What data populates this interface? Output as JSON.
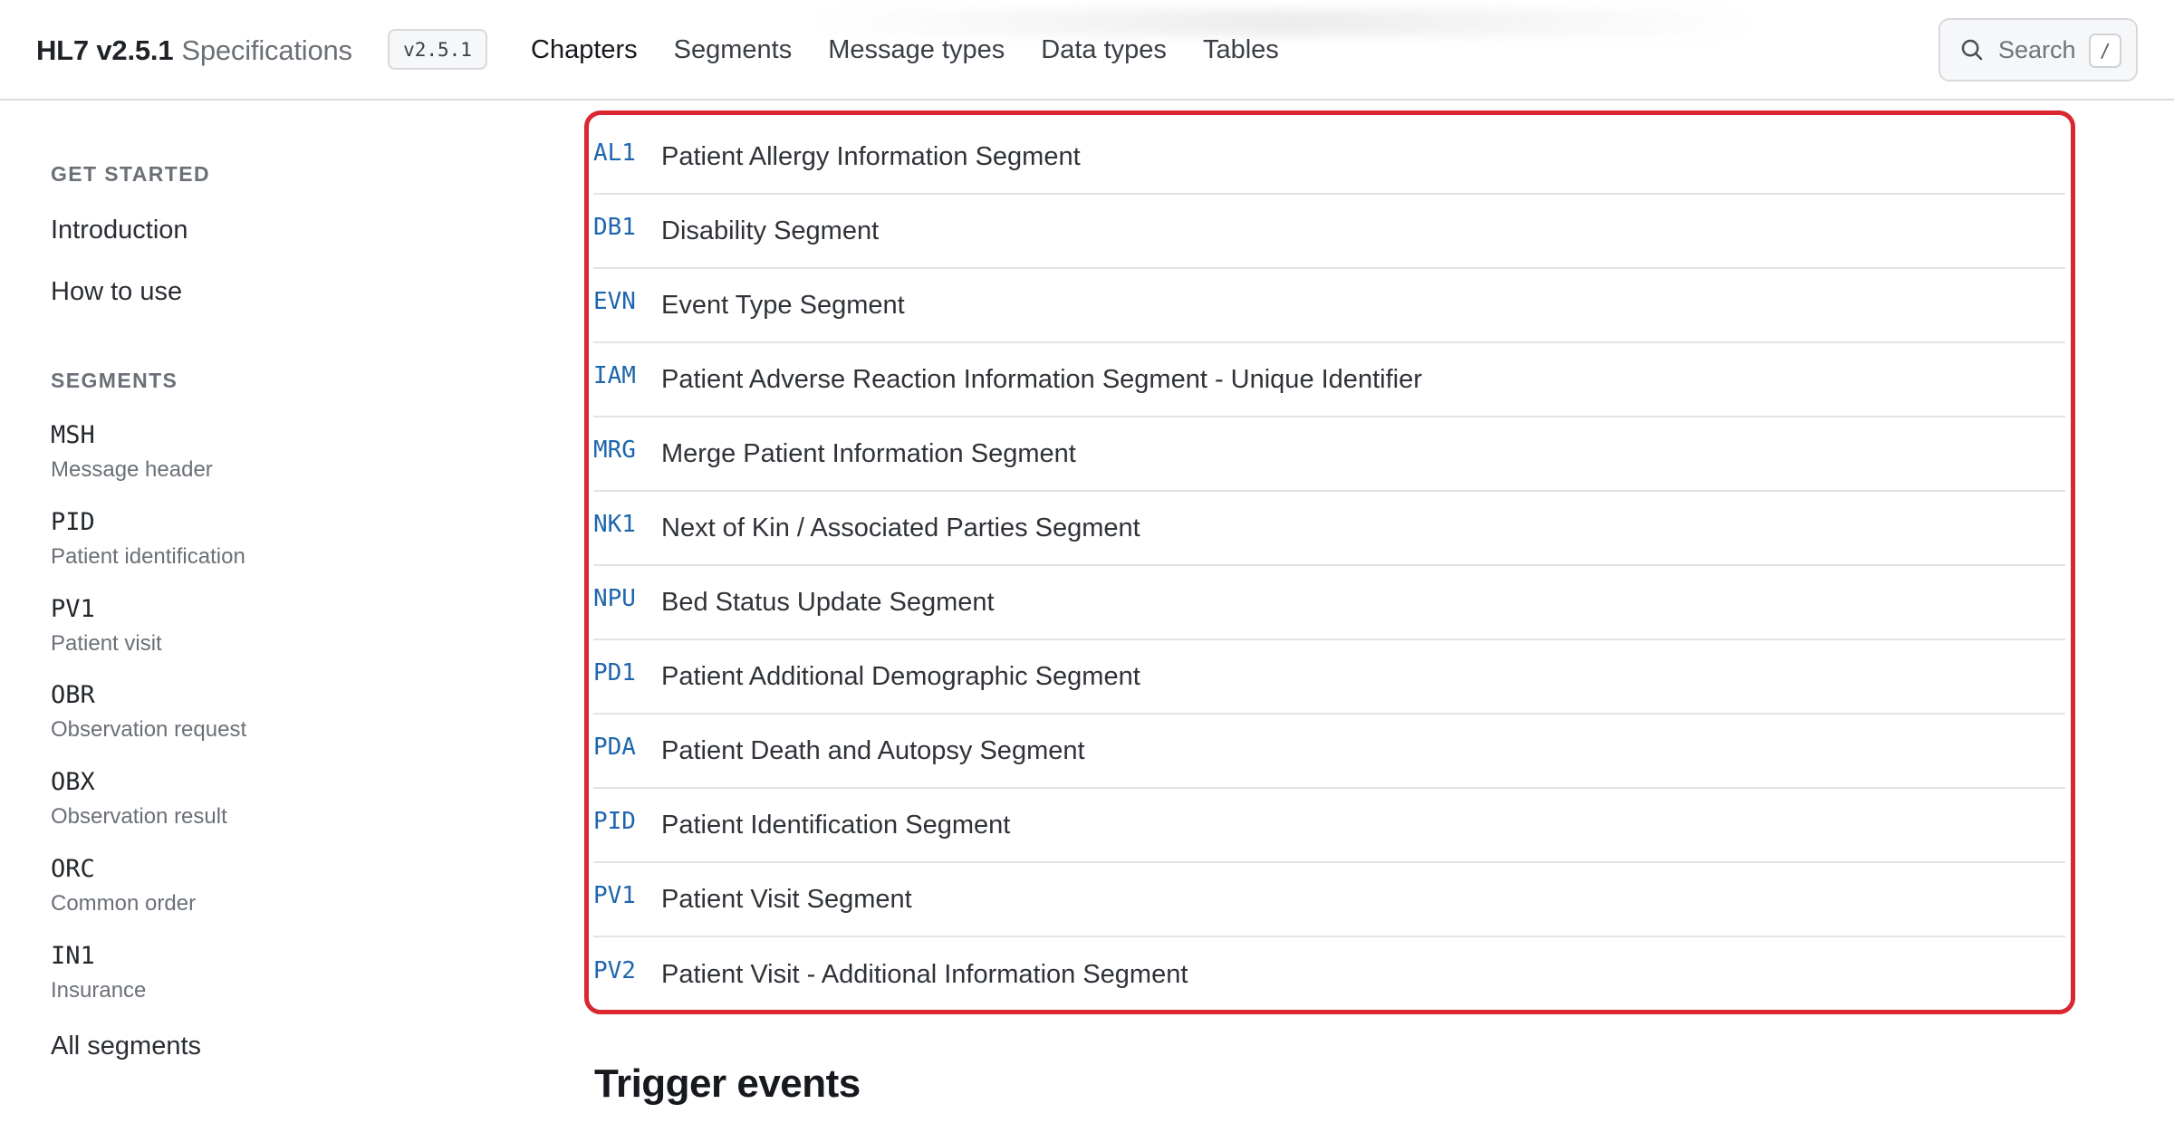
{
  "header": {
    "brand_strong": "HL7 v2.5.1",
    "brand_light": "Specifications",
    "version": "v2.5.1",
    "nav": [
      {
        "label": "Chapters"
      },
      {
        "label": "Segments"
      },
      {
        "label": "Message types"
      },
      {
        "label": "Data types"
      },
      {
        "label": "Tables"
      }
    ],
    "search": {
      "placeholder": "Search",
      "shortcut": "/"
    }
  },
  "sidebar": {
    "get_started_title": "GET STARTED",
    "get_started_links": [
      {
        "label": "Introduction"
      },
      {
        "label": "How to use"
      }
    ],
    "segments_title": "SEGMENTS",
    "segments": [
      {
        "code": "MSH",
        "desc": "Message header"
      },
      {
        "code": "PID",
        "desc": "Patient identification"
      },
      {
        "code": "PV1",
        "desc": "Patient visit"
      },
      {
        "code": "OBR",
        "desc": "Observation request"
      },
      {
        "code": "OBX",
        "desc": "Observation result"
      },
      {
        "code": "ORC",
        "desc": "Common order"
      },
      {
        "code": "IN1",
        "desc": "Insurance"
      }
    ],
    "all_segments": "All segments"
  },
  "main": {
    "segment_rows": [
      {
        "code": "AL1",
        "name": "Patient Allergy Information Segment"
      },
      {
        "code": "DB1",
        "name": "Disability Segment"
      },
      {
        "code": "EVN",
        "name": "Event Type Segment"
      },
      {
        "code": "IAM",
        "name": "Patient Adverse Reaction Information Segment - Unique Identifier"
      },
      {
        "code": "MRG",
        "name": "Merge Patient Information Segment"
      },
      {
        "code": "NK1",
        "name": "Next of Kin / Associated Parties Segment"
      },
      {
        "code": "NPU",
        "name": "Bed Status Update Segment"
      },
      {
        "code": "PD1",
        "name": "Patient Additional Demographic Segment"
      },
      {
        "code": "PDA",
        "name": "Patient Death and Autopsy Segment"
      },
      {
        "code": "PID",
        "name": "Patient Identification Segment"
      },
      {
        "code": "PV1",
        "name": "Patient Visit Segment"
      },
      {
        "code": "PV2",
        "name": "Patient Visit - Additional Information Segment"
      }
    ],
    "trigger_events_heading": "Trigger events"
  },
  "colors": {
    "highlight_border": "#d9262f",
    "segment_code": "#1e66ad"
  }
}
